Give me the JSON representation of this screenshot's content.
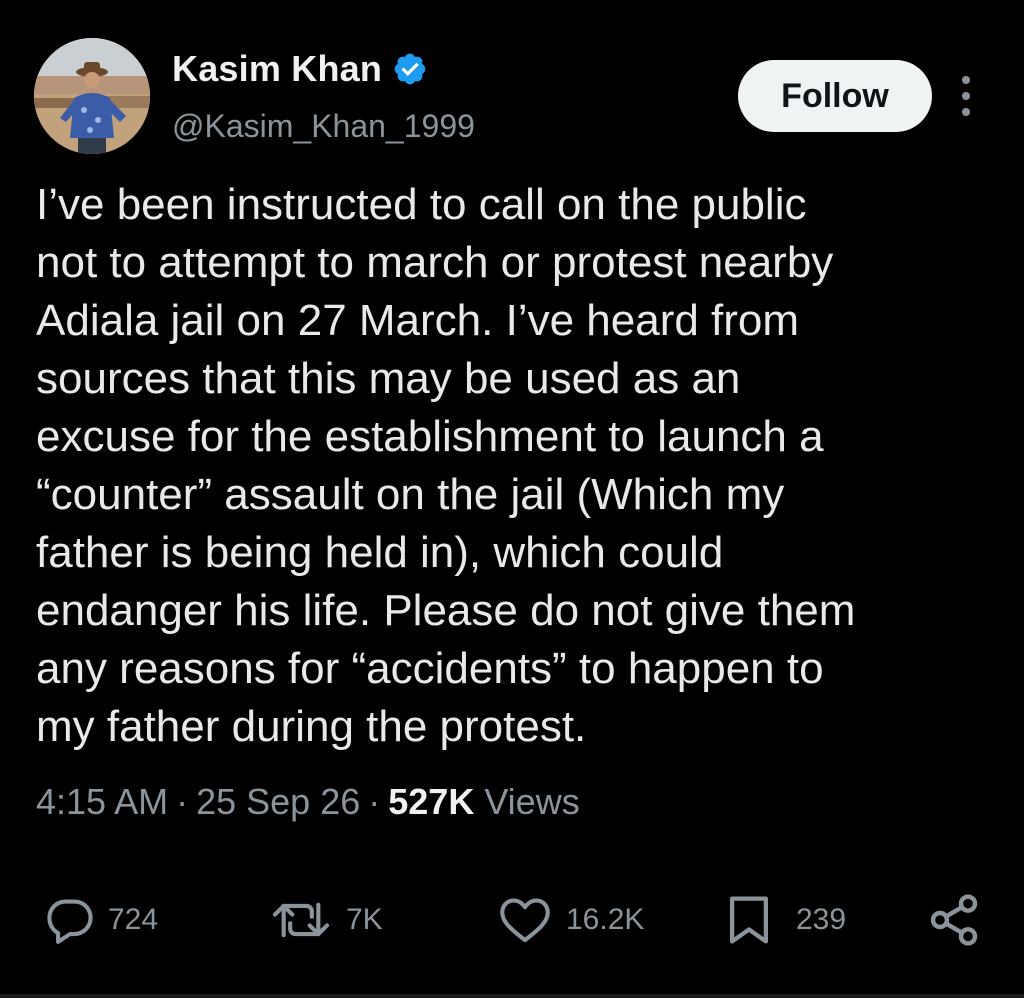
{
  "author": {
    "display_name": "Kasim Khan",
    "handle": "@Kasim_Khan_1999",
    "verified": true,
    "verified_color": "#1d9bf0"
  },
  "follow_button": {
    "label": "Follow"
  },
  "tweet": {
    "lines": [
      "I’ve been instructed to call on the public",
      "not to attempt to march or protest nearby",
      "Adiala jail on 27 March. I’ve heard from",
      "sources that this may be used as an",
      "excuse for the establishment to launch a",
      "“counter” assault on the jail (Which my",
      "father is being held in), which could",
      "endanger his life. Please do not give them",
      "any reasons for “accidents” to happen to",
      "my father during the protest."
    ],
    "time": "4:15 AM",
    "date": "25 Sep 26",
    "views_count": "527K",
    "views_label": "Views"
  },
  "actions": {
    "replies": "724",
    "reposts": "7K",
    "likes": "16.2K",
    "bookmarks": "239"
  },
  "icons": [
    "verified-badge-icon",
    "more-options-icon",
    "reply-icon",
    "repost-icon",
    "like-icon",
    "bookmark-icon",
    "share-icon"
  ],
  "colors": {
    "background": "#000000",
    "text": "#e7e9ea",
    "muted": "#8b949a",
    "button_bg": "#eff3f4"
  }
}
